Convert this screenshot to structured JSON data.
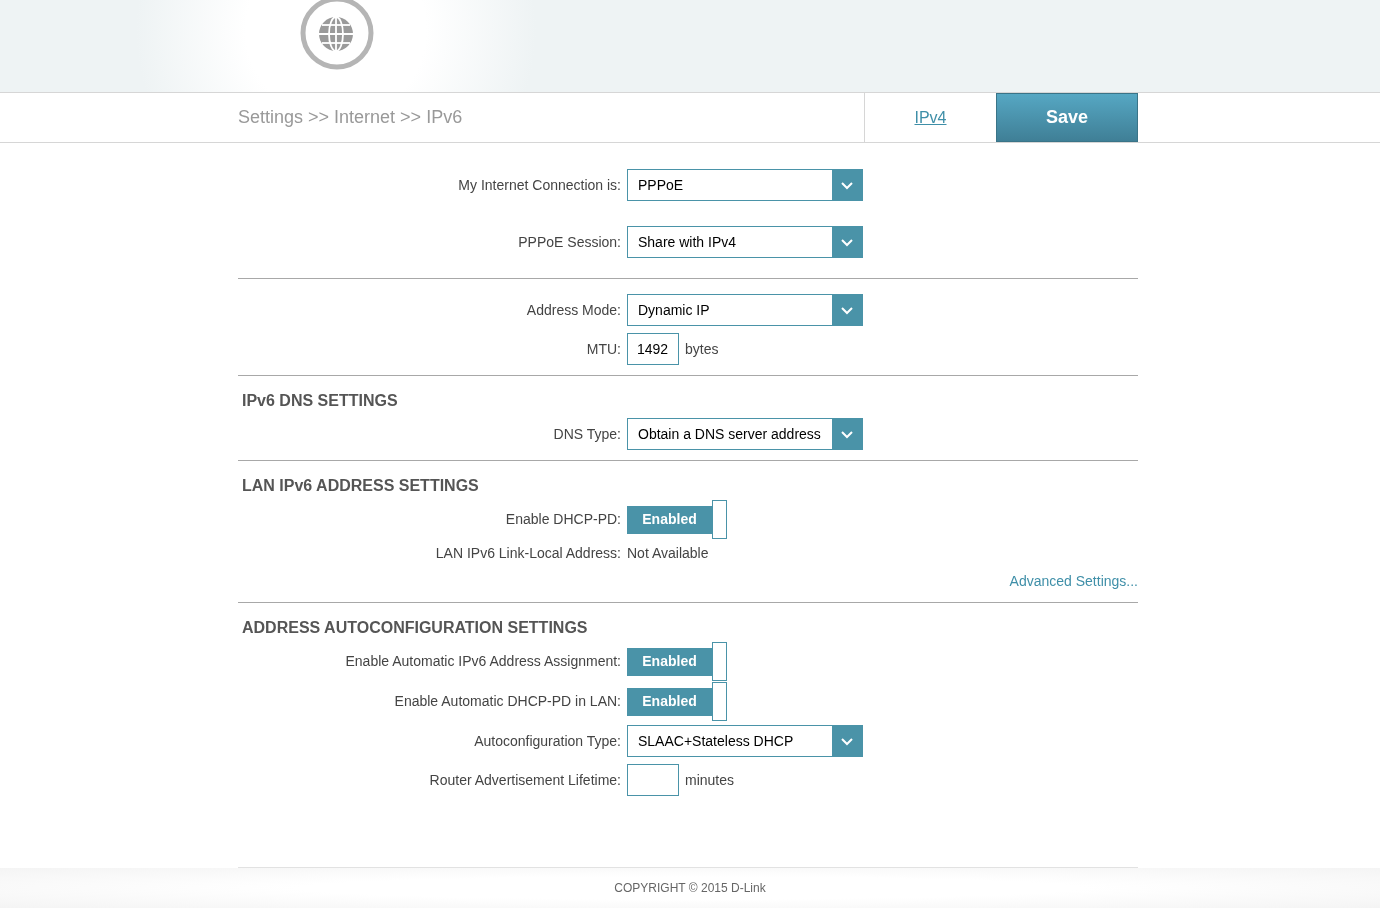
{
  "breadcrumb": "Settings >> Internet >> IPv6",
  "nav": {
    "tab": "IPv4",
    "save": "Save"
  },
  "sections": [
    {
      "rows": [
        {
          "kind": "select",
          "label": "My Internet Connection is:",
          "value": "PPPoE"
        },
        {
          "kind": "select",
          "label": "PPPoE Session:",
          "value": "Share with IPv4"
        }
      ]
    },
    {
      "rows": [
        {
          "kind": "select",
          "label": "Address Mode:",
          "value": "Dynamic IP"
        },
        {
          "kind": "input",
          "label": "MTU:",
          "value": "1492",
          "suffix": "bytes"
        }
      ]
    },
    {
      "heading": "IPv6 DNS SETTINGS",
      "rows": [
        {
          "kind": "select",
          "label": "DNS Type:",
          "value": "Obtain a DNS server address"
        }
      ]
    },
    {
      "heading": "LAN IPv6 ADDRESS SETTINGS",
      "rows": [
        {
          "kind": "toggle",
          "label": "Enable DHCP-PD:",
          "value": "Enabled",
          "on": true
        },
        {
          "kind": "text",
          "label": "LAN IPv6 Link-Local Address:",
          "value": "Not Available"
        },
        {
          "kind": "link",
          "value": "Advanced Settings..."
        }
      ]
    },
    {
      "heading": "ADDRESS AUTOCONFIGURATION SETTINGS",
      "rows": [
        {
          "kind": "toggle",
          "label": "Enable Automatic IPv6 Address Assignment:",
          "value": "Enabled",
          "on": true
        },
        {
          "kind": "toggle",
          "label": "Enable Automatic DHCP-PD in LAN:",
          "value": "Enabled",
          "on": true
        },
        {
          "kind": "select",
          "label": "Autoconfiguration Type:",
          "value": "SLAAC+Stateless DHCP"
        },
        {
          "kind": "input",
          "label": "Router Advertisement Lifetime:",
          "value": "",
          "suffix": "minutes"
        }
      ]
    }
  ],
  "footer": "COPYRIGHT © 2015 D-Link"
}
